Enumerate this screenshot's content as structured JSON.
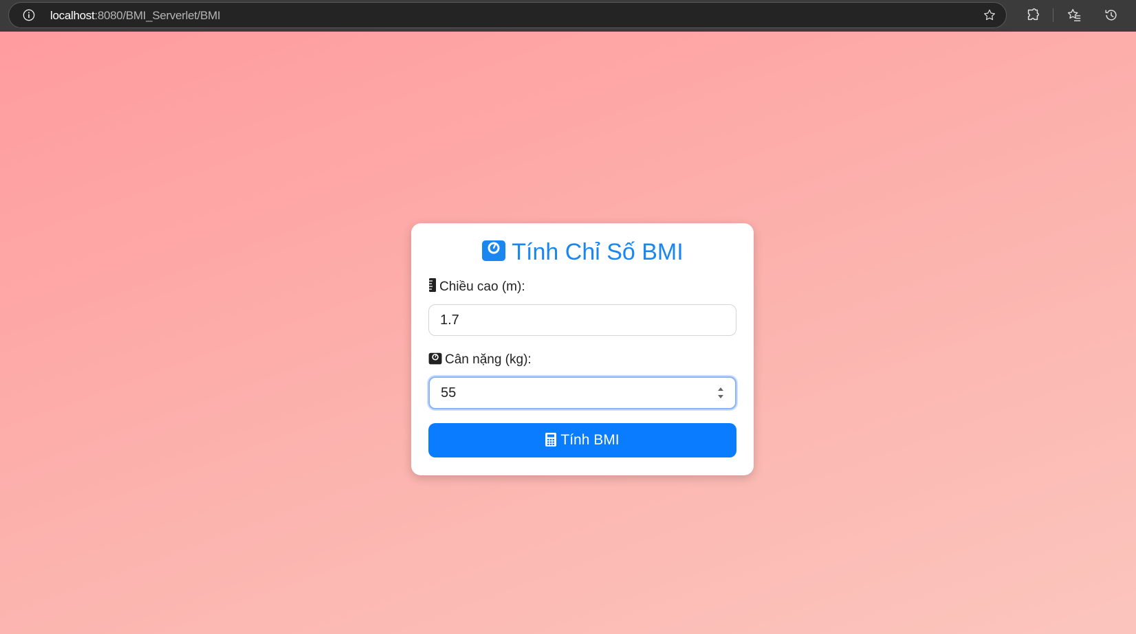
{
  "browser": {
    "url_host": "localhost",
    "url_path": ":8080/BMI_Serverlet/BMI"
  },
  "form": {
    "title": "Tính Chỉ Số BMI",
    "title_icon": "weight-scale-icon",
    "height_label": "Chiều cao (m):",
    "height_icon": "ruler-icon",
    "height_value": "1.7",
    "weight_label": "Cân nặng (kg):",
    "weight_icon": "weight-scale-icon",
    "weight_value": "55",
    "submit_label": "Tính BMI",
    "submit_icon": "calculator-icon"
  },
  "colors": {
    "accent": "#0a7cff",
    "title": "#1a86f0",
    "background_start": "#ff9a9e",
    "background_end": "#fbc5bd"
  }
}
